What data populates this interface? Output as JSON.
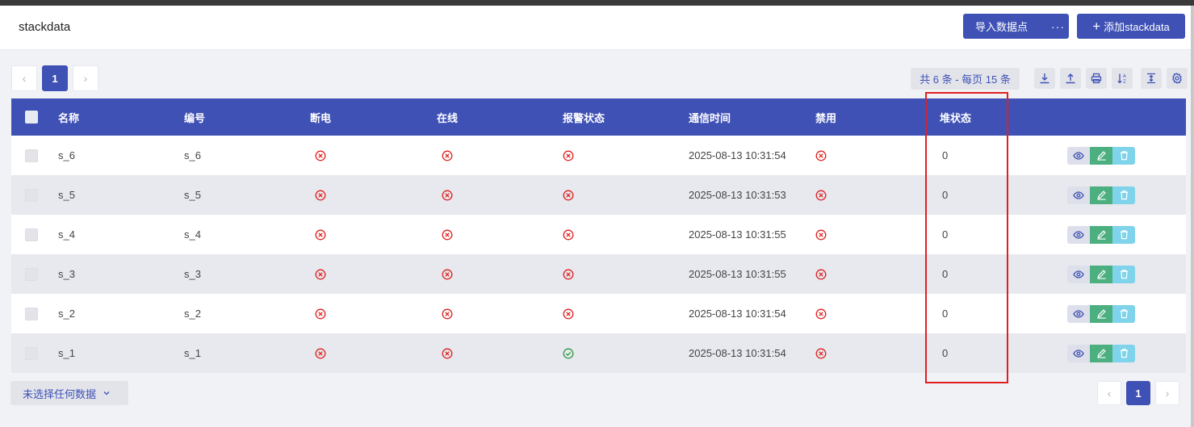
{
  "header": {
    "title": "stackdata",
    "import_label": "导入数据点",
    "more_label": "···",
    "add_label": "添加stackdata"
  },
  "pagination": {
    "prev": "‹",
    "current_page": "1",
    "next": "›",
    "summary": "共 6 条 - 每页 15 条"
  },
  "toolbar": {
    "icons": [
      "download-icon",
      "upload-icon",
      "print-icon",
      "sort-icon",
      "column-height-icon",
      "settings-icon"
    ]
  },
  "table": {
    "columns": [
      "名称",
      "编号",
      "断电",
      "在线",
      "报警状态",
      "通信时间",
      "禁用",
      "堆状态"
    ],
    "rows": [
      {
        "name": "s_6",
        "code": "s_6",
        "power_off": "error",
        "online": "error",
        "alarm": "error",
        "time": "2025-08-13 10:31:54",
        "disabled": "error",
        "stack_state": "0"
      },
      {
        "name": "s_5",
        "code": "s_5",
        "power_off": "error",
        "online": "error",
        "alarm": "error",
        "time": "2025-08-13 10:31:53",
        "disabled": "error",
        "stack_state": "0"
      },
      {
        "name": "s_4",
        "code": "s_4",
        "power_off": "error",
        "online": "error",
        "alarm": "error",
        "time": "2025-08-13 10:31:55",
        "disabled": "error",
        "stack_state": "0"
      },
      {
        "name": "s_3",
        "code": "s_3",
        "power_off": "error",
        "online": "error",
        "alarm": "error",
        "time": "2025-08-13 10:31:55",
        "disabled": "error",
        "stack_state": "0"
      },
      {
        "name": "s_2",
        "code": "s_2",
        "power_off": "error",
        "online": "error",
        "alarm": "error",
        "time": "2025-08-13 10:31:54",
        "disabled": "error",
        "stack_state": "0"
      },
      {
        "name": "s_1",
        "code": "s_1",
        "power_off": "error",
        "online": "error",
        "alarm": "ok",
        "time": "2025-08-13 10:31:54",
        "disabled": "error",
        "stack_state": "0"
      }
    ]
  },
  "footer": {
    "selection_label": "未选择任何数据"
  },
  "colors": {
    "primary": "#3f51b5",
    "error": "#e02020",
    "ok": "#2e9a3e",
    "edit": "#4caf80",
    "delete": "#7fd3ea",
    "highlight": "#e02020"
  }
}
